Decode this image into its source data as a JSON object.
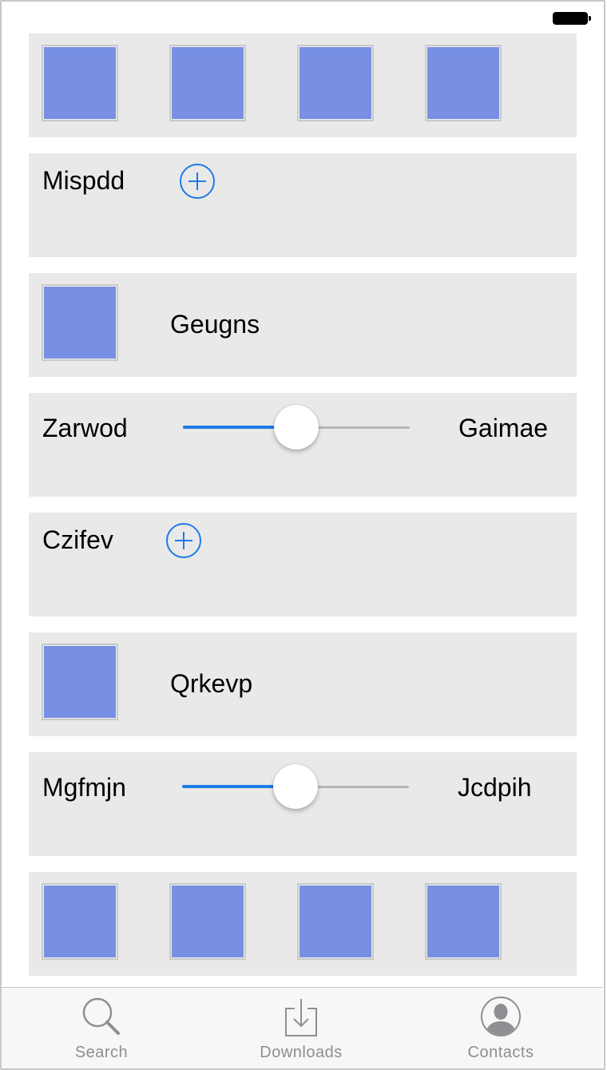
{
  "status_bar": {
    "battery_icon": "battery-icon"
  },
  "rows": [
    {
      "type": "images",
      "count": 4
    },
    {
      "type": "add",
      "label": "Mispdd",
      "icon": "plus-circle-icon"
    },
    {
      "type": "image_label",
      "label": "Geugns"
    },
    {
      "type": "slider",
      "left_label": "Zarwod",
      "right_label": "Gaimae",
      "value": 0.5
    },
    {
      "type": "add",
      "label": "Czifev",
      "icon": "plus-circle-icon"
    },
    {
      "type": "image_label",
      "label": "Qrkevp"
    },
    {
      "type": "slider",
      "left_label": "Mgfmjn",
      "right_label": "Jcdpih",
      "value": 0.5
    },
    {
      "type": "images",
      "count": 4
    }
  ],
  "tabbar": {
    "tabs": [
      {
        "label": "Search",
        "icon": "search-icon"
      },
      {
        "label": "Downloads",
        "icon": "downloads-icon"
      },
      {
        "label": "Contacts",
        "icon": "contacts-icon"
      }
    ]
  },
  "colors": {
    "accent": "#1e7ae6",
    "image_fill": "#7790e4",
    "cell_background": "#e9e9e9",
    "tab_label": "#8e8e93"
  }
}
